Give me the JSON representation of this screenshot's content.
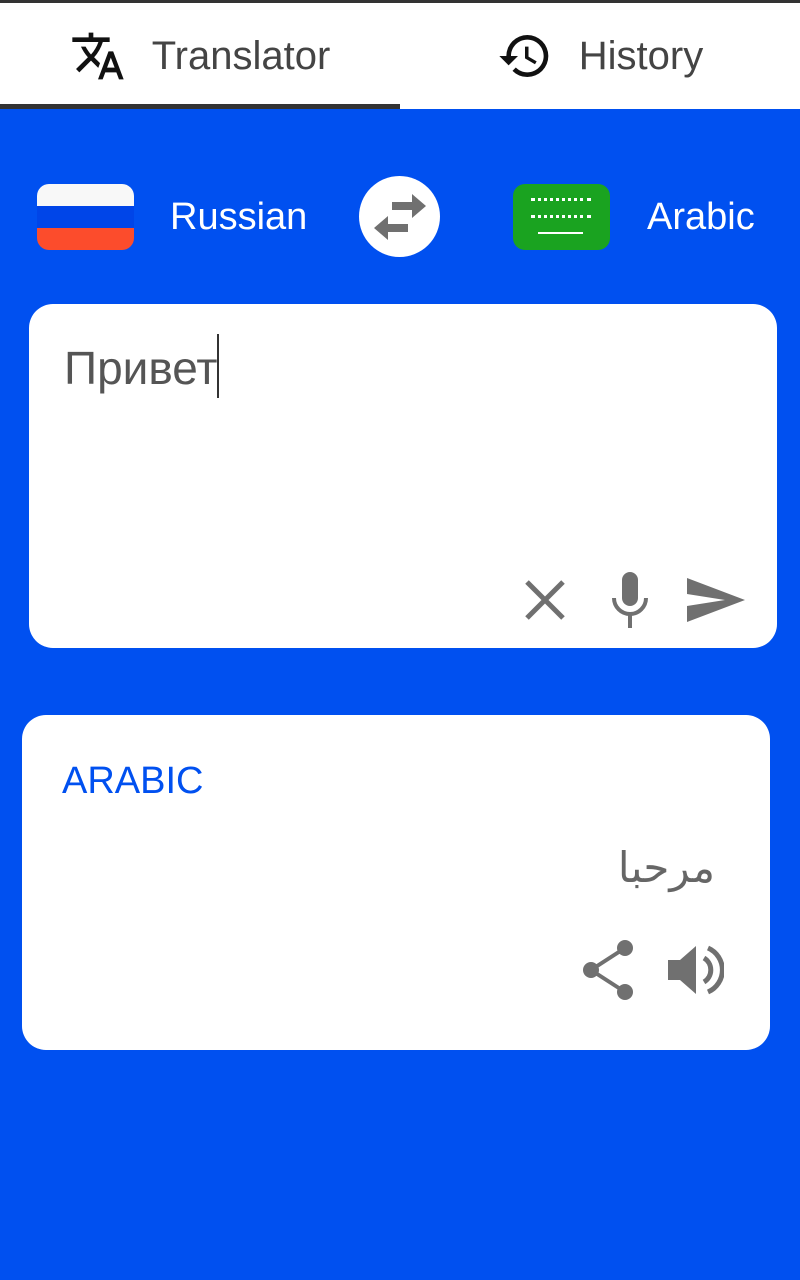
{
  "tabs": [
    {
      "label": "Translator",
      "icon": "translate-icon",
      "active": true
    },
    {
      "label": "History",
      "icon": "history-icon",
      "active": false
    }
  ],
  "languages": {
    "source": {
      "name": "Russian",
      "flag": "russia-flag"
    },
    "target": {
      "name": "Arabic",
      "flag": "saudi-arabia-flag"
    }
  },
  "input": {
    "value": "Привет"
  },
  "output": {
    "language_label": "ARABIC",
    "text": "مرحبا"
  },
  "colors": {
    "primary": "#0050f0",
    "icon_gray": "#707070"
  }
}
